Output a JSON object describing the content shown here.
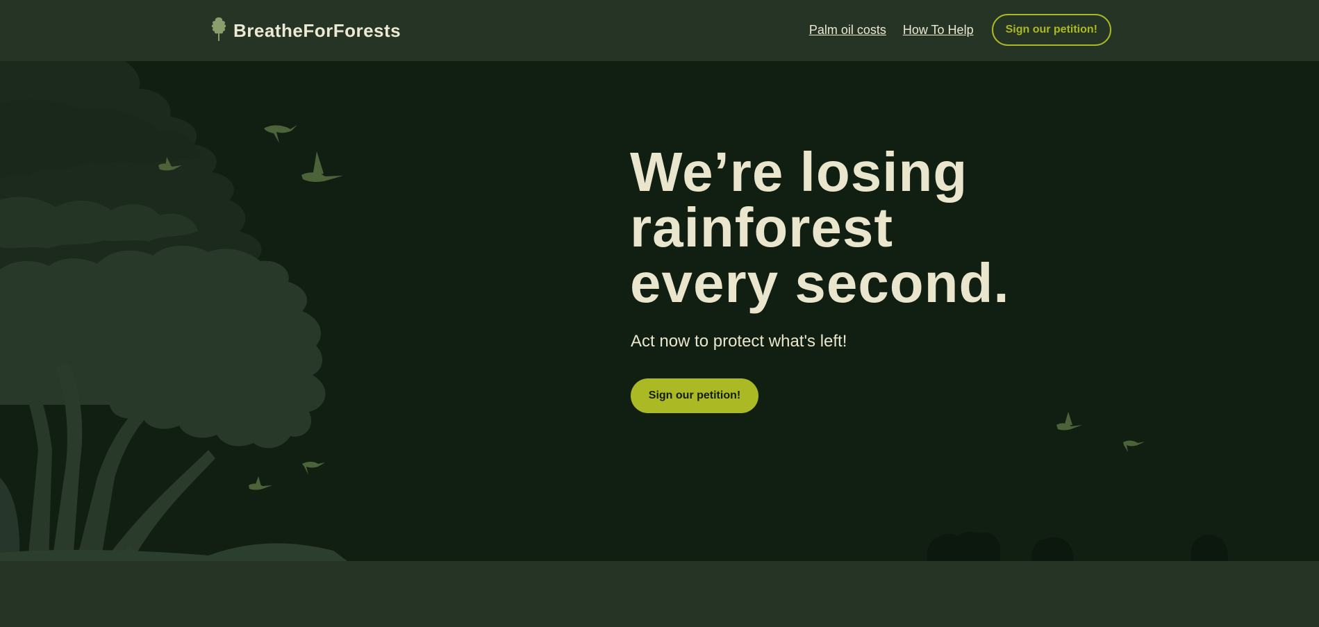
{
  "nav": {
    "brand": "BreatheForForests",
    "logo_icon": "tree-icon",
    "links": [
      "Palm oil costs",
      "How To Help"
    ],
    "cta": "Sign our petition!"
  },
  "hero": {
    "headline_lines": [
      "We’re losing",
      "rainforest",
      "every second."
    ],
    "subhead": "Act now to protect what's left!",
    "cta": "Sign our petition!"
  },
  "colors": {
    "nav_bg": "#263426",
    "hero_bg": "#111F12",
    "accent": "#AAB924",
    "text": "#E9E6CD",
    "bird": "#4C6239",
    "tree_dark": "#1C2A1D",
    "tree_light": "#28392A"
  }
}
